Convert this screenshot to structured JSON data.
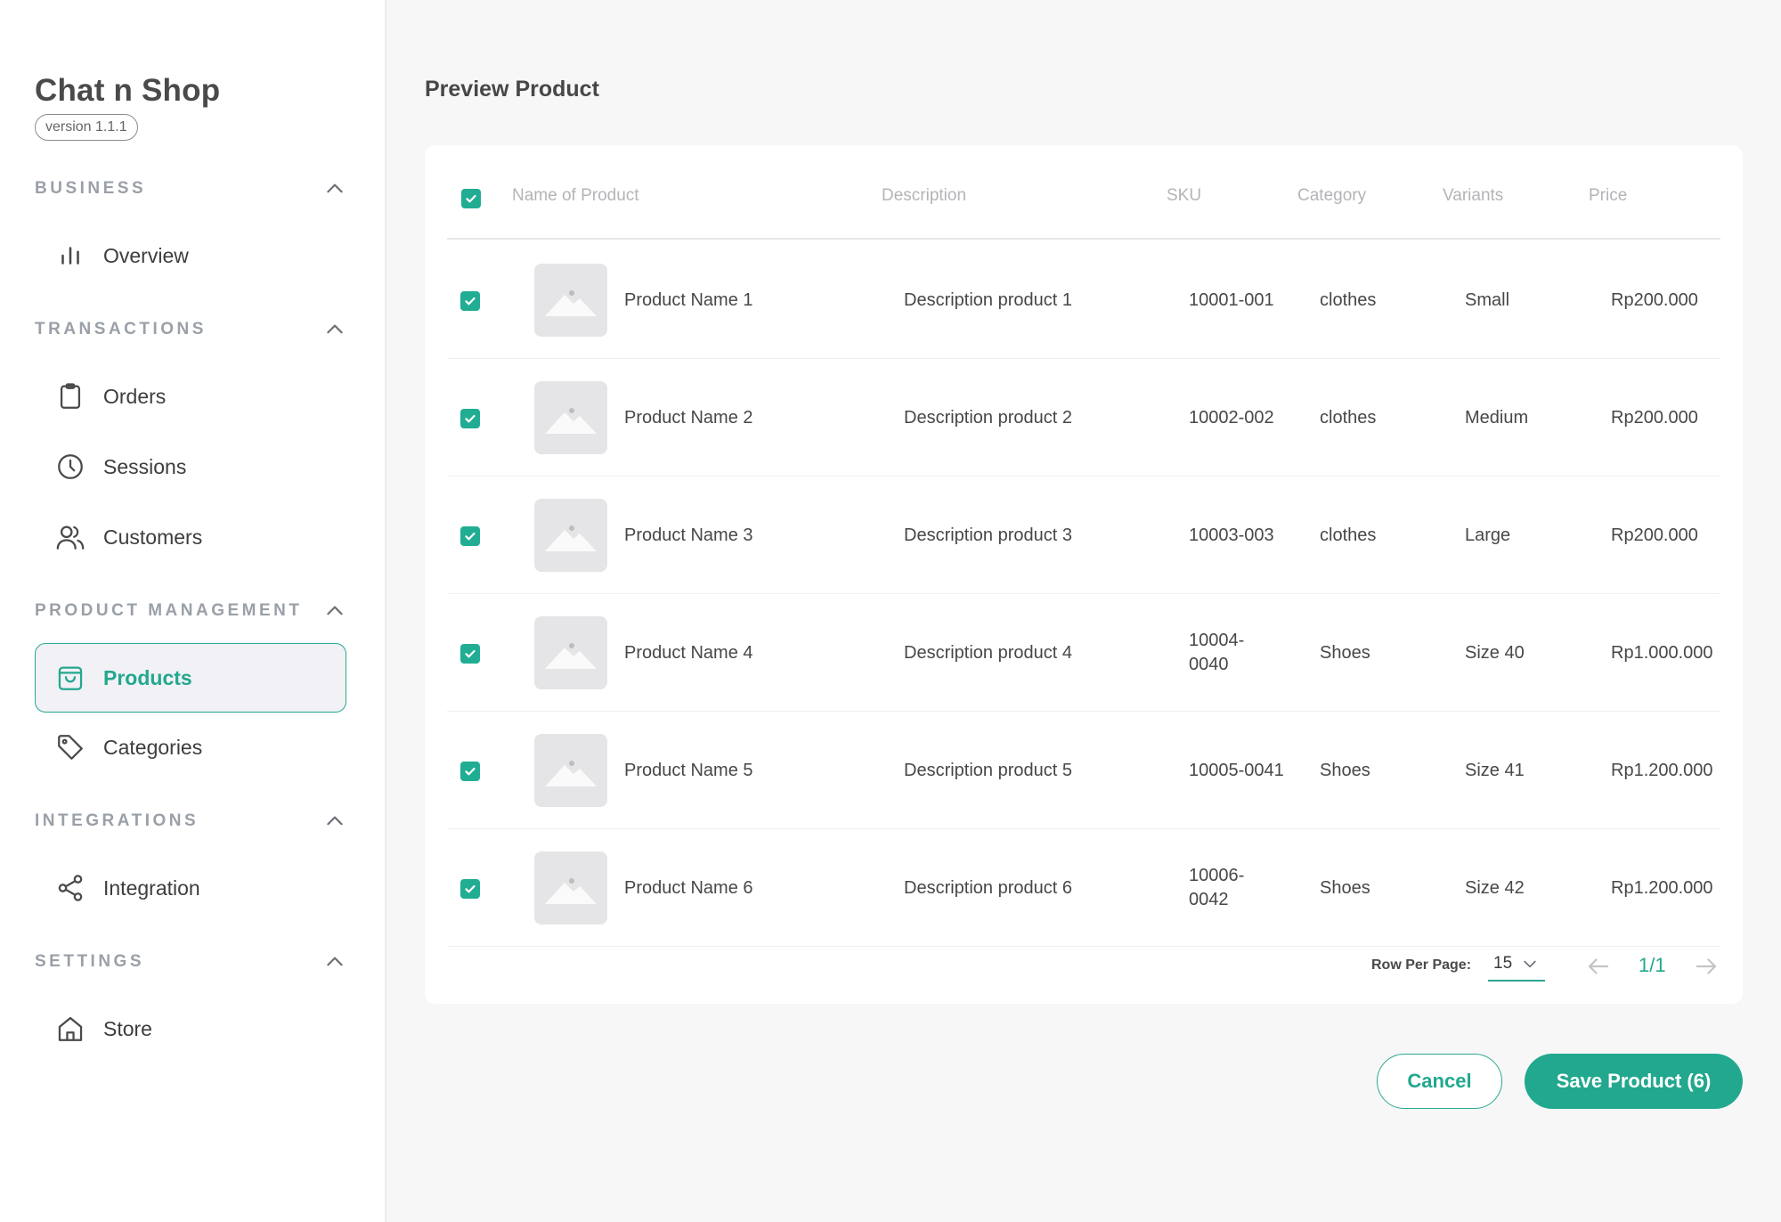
{
  "app": {
    "title": "Chat n Shop",
    "version": "version 1.1.1"
  },
  "sidebar": {
    "sections": [
      {
        "title": "BUSINESS",
        "items": [
          {
            "label": "Overview",
            "icon": "bar-chart-icon"
          }
        ]
      },
      {
        "title": "TRANSACTIONS",
        "items": [
          {
            "label": "Orders",
            "icon": "clipboard-icon"
          },
          {
            "label": "Sessions",
            "icon": "clock-icon"
          },
          {
            "label": "Customers",
            "icon": "users-icon"
          }
        ]
      },
      {
        "title": "PRODUCT MANAGEMENT",
        "items": [
          {
            "label": "Products",
            "icon": "shopping-bag-icon",
            "active": true
          },
          {
            "label": "Categories",
            "icon": "tag-icon"
          }
        ]
      },
      {
        "title": "INTEGRATIONS",
        "items": [
          {
            "label": "Integration",
            "icon": "share-icon"
          }
        ]
      },
      {
        "title": "SETTINGS",
        "items": [
          {
            "label": "Store",
            "icon": "home-icon"
          }
        ]
      }
    ]
  },
  "main": {
    "title": "Preview Product",
    "table": {
      "columns": [
        "Name of Product",
        "Description",
        "SKU",
        "Category",
        "Variants",
        "Price"
      ],
      "rows": [
        {
          "checked": true,
          "name": "Product Name 1",
          "description": "Description product 1",
          "sku": "10001-001",
          "category": "clothes",
          "variant": "Small",
          "price": "Rp200.000"
        },
        {
          "checked": true,
          "name": "Product Name 2",
          "description": "Description product 2",
          "sku": "10002-002",
          "category": "clothes",
          "variant": "Medium",
          "price": "Rp200.000"
        },
        {
          "checked": true,
          "name": "Product Name 3",
          "description": "Description product 3",
          "sku": "10003-003",
          "category": "clothes",
          "variant": "Large",
          "price": "Rp200.000"
        },
        {
          "checked": true,
          "name": "Product Name 4",
          "description": "Description product 4",
          "sku": "10004-0040",
          "category": "Shoes",
          "variant": "Size 40",
          "price": "Rp1.000.000"
        },
        {
          "checked": true,
          "name": "Product Name 5",
          "description": "Description product 5",
          "sku": "10005-0041",
          "category": "Shoes",
          "variant": "Size 41",
          "price": "Rp1.200.000"
        },
        {
          "checked": true,
          "name": "Product Name 6",
          "description": "Description product 6",
          "sku": "10006-0042",
          "category": "Shoes",
          "variant": "Size 42",
          "price": "Rp1.200.000"
        }
      ]
    },
    "pagination": {
      "rows_label": "Row Per Page:",
      "rows_value": "15",
      "page": "1/1"
    },
    "actions": {
      "cancel_label": "Cancel",
      "save_label": "Save Product (6)"
    }
  },
  "colors": {
    "accent": "#22a88e",
    "muted": "#9aa0a8",
    "text": "#474747"
  }
}
